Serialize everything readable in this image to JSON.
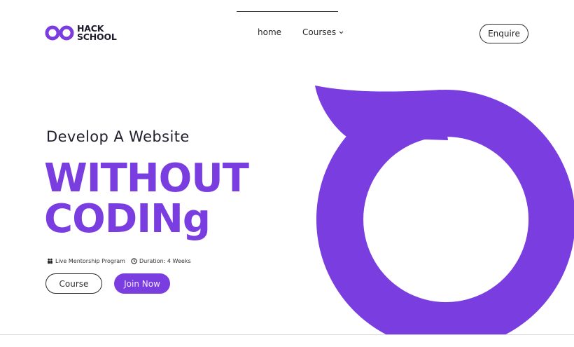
{
  "brand": {
    "logo_line1": "HACK",
    "logo_line2": "SCHOOL",
    "accent_color": "#7a3de0"
  },
  "nav": {
    "home_label": "home",
    "courses_label": "Courses",
    "enquire_label": "Enquire"
  },
  "hero": {
    "subtitle": "Develop A Website",
    "headline_line1": "WITHOUT",
    "headline_line2": "CODINg",
    "meta": {
      "program_label": "Live Mentorship Program",
      "program_icon": "people-icon",
      "duration_label": "Duration: 4 Weeks",
      "duration_icon": "clock-icon"
    },
    "course_button": "Course",
    "join_button": "Join Now"
  }
}
